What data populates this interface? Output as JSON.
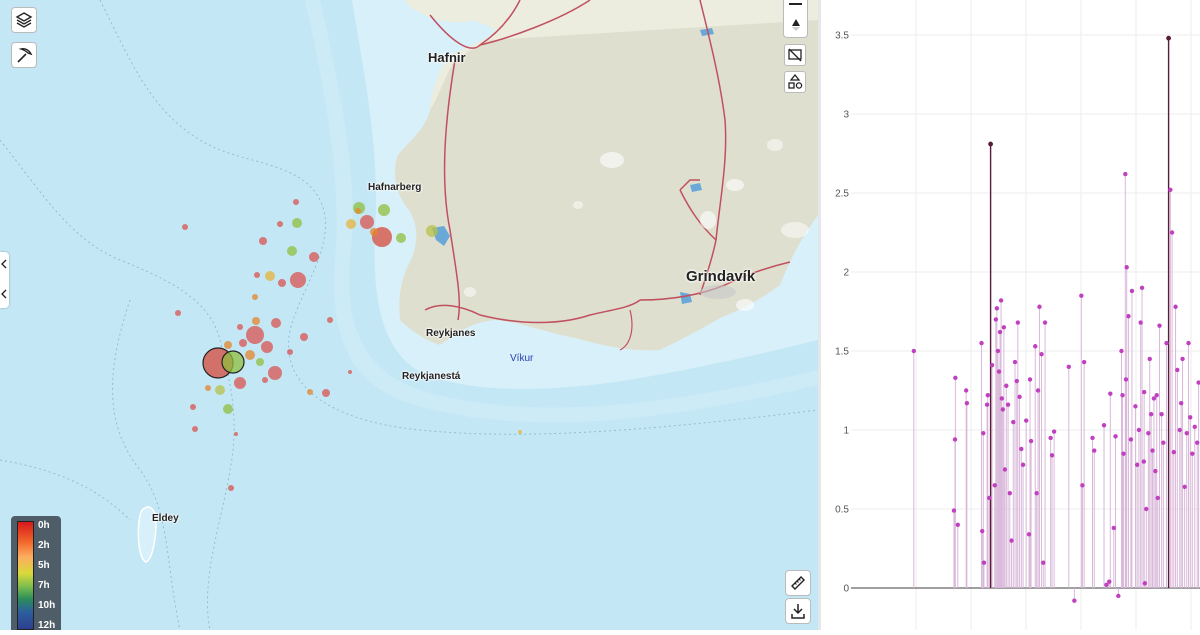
{
  "map": {
    "places": {
      "hafnir": "Hafnir",
      "hafnarberg": "Hafnarberg",
      "grindavik": "Grindavík",
      "reykjanes": "Reykjanes",
      "reykjanesta": "Reykjanestá",
      "vikur": "Víkur",
      "eldey": "Eldey"
    },
    "controls": {
      "layers_icon": "layers-icon",
      "pickaxe_icon": "pickaxe-icon",
      "zoom_out_icon": "minus-icon",
      "compass_icon": "compass-icon",
      "hide_icon": "hide-layer-icon",
      "shapes_icon": "shapes-icon",
      "ruler_icon": "ruler-icon",
      "download_icon": "download-icon"
    },
    "legend": {
      "labels": [
        "0h",
        "2h",
        "5h",
        "7h",
        "10h",
        "12h"
      ],
      "colors": [
        "#d7191c",
        "#f0652a",
        "#fdae61",
        "#d9d93a",
        "#7fbf4d",
        "#2b8c5a",
        "#2c5f9e",
        "#2c3f8f"
      ]
    }
  },
  "chart_data": {
    "type": "scatter",
    "ytick_labels": [
      "0",
      "0.5",
      "1",
      "1.5",
      "2",
      "2.5",
      "3",
      "3.5"
    ],
    "ylim": [
      -0.2,
      3.7
    ],
    "xlim": [
      0,
      100
    ],
    "grid": true,
    "stems": true,
    "colors": {
      "marker": "#c040c0",
      "highlight": "#5a1a3a",
      "stem": "#d9b8d9"
    },
    "points": [
      {
        "x": 18,
        "y": 1.5
      },
      {
        "x": 29.5,
        "y": 0.49
      },
      {
        "x": 29.8,
        "y": 0.94
      },
      {
        "x": 29.9,
        "y": 1.33
      },
      {
        "x": 30.6,
        "y": 0.4
      },
      {
        "x": 33,
        "y": 1.25
      },
      {
        "x": 33.2,
        "y": 1.17
      },
      {
        "x": 37.4,
        "y": 1.55
      },
      {
        "x": 37.6,
        "y": 0.36
      },
      {
        "x": 37.9,
        "y": 0.98
      },
      {
        "x": 38.1,
        "y": 0.16
      },
      {
        "x": 39,
        "y": 1.16
      },
      {
        "x": 39.2,
        "y": 1.22
      },
      {
        "x": 39.6,
        "y": 0.57
      },
      {
        "x": 40,
        "y": 2.81
      },
      {
        "x": 40.4,
        "y": 1.41
      },
      {
        "x": 41.2,
        "y": 0.65
      },
      {
        "x": 41.5,
        "y": 1.7
      },
      {
        "x": 41.8,
        "y": 1.77
      },
      {
        "x": 42.1,
        "y": 1.5
      },
      {
        "x": 42.4,
        "y": 1.37
      },
      {
        "x": 42.7,
        "y": 1.62
      },
      {
        "x": 43,
        "y": 1.82
      },
      {
        "x": 43.2,
        "y": 1.2
      },
      {
        "x": 43.5,
        "y": 1.13
      },
      {
        "x": 43.8,
        "y": 1.65
      },
      {
        "x": 44.1,
        "y": 0.75
      },
      {
        "x": 44.5,
        "y": 1.28
      },
      {
        "x": 45,
        "y": 1.16
      },
      {
        "x": 45.5,
        "y": 0.6
      },
      {
        "x": 46,
        "y": 0.3
      },
      {
        "x": 46.5,
        "y": 1.05
      },
      {
        "x": 47,
        "y": 1.43
      },
      {
        "x": 47.5,
        "y": 1.31
      },
      {
        "x": 47.8,
        "y": 1.68
      },
      {
        "x": 48.3,
        "y": 1.21
      },
      {
        "x": 48.8,
        "y": 0.88
      },
      {
        "x": 49.3,
        "y": 0.78
      },
      {
        "x": 50.2,
        "y": 1.06
      },
      {
        "x": 51,
        "y": 0.34
      },
      {
        "x": 51.3,
        "y": 1.32
      },
      {
        "x": 51.6,
        "y": 0.93
      },
      {
        "x": 52.8,
        "y": 1.53
      },
      {
        "x": 53.2,
        "y": 0.6
      },
      {
        "x": 53.6,
        "y": 1.25
      },
      {
        "x": 54,
        "y": 1.78
      },
      {
        "x": 54.6,
        "y": 1.48
      },
      {
        "x": 55.1,
        "y": 0.16
      },
      {
        "x": 55.6,
        "y": 1.68
      },
      {
        "x": 57.2,
        "y": 0.95
      },
      {
        "x": 57.6,
        "y": 0.84
      },
      {
        "x": 58.2,
        "y": 0.99
      },
      {
        "x": 62.4,
        "y": 1.4
      },
      {
        "x": 64,
        "y": -0.08
      },
      {
        "x": 66,
        "y": 1.85
      },
      {
        "x": 66.3,
        "y": 0.65
      },
      {
        "x": 66.8,
        "y": 1.43
      },
      {
        "x": 69.2,
        "y": 0.95
      },
      {
        "x": 69.7,
        "y": 0.87
      },
      {
        "x": 72.5,
        "y": 1.03
      },
      {
        "x": 73.2,
        "y": 0.02
      },
      {
        "x": 74,
        "y": 0.04
      },
      {
        "x": 74.3,
        "y": 1.23
      },
      {
        "x": 75.3,
        "y": 0.38
      },
      {
        "x": 75.8,
        "y": 0.96
      },
      {
        "x": 76.6,
        "y": -0.05
      },
      {
        "x": 77.5,
        "y": 1.5
      },
      {
        "x": 77.8,
        "y": 1.22
      },
      {
        "x": 78.1,
        "y": 0.85
      },
      {
        "x": 78.6,
        "y": 2.62
      },
      {
        "x": 78.8,
        "y": 1.32
      },
      {
        "x": 79,
        "y": 2.03
      },
      {
        "x": 79.5,
        "y": 1.72
      },
      {
        "x": 80.2,
        "y": 0.94
      },
      {
        "x": 80.5,
        "y": 1.88
      },
      {
        "x": 81.5,
        "y": 1.15
      },
      {
        "x": 82,
        "y": 0.78
      },
      {
        "x": 82.5,
        "y": 1.0
      },
      {
        "x": 83,
        "y": 1.68
      },
      {
        "x": 83.4,
        "y": 1.9
      },
      {
        "x": 83.9,
        "y": 0.8
      },
      {
        "x": 84,
        "y": 1.24
      },
      {
        "x": 84.2,
        "y": 0.03
      },
      {
        "x": 84.6,
        "y": 0.5
      },
      {
        "x": 85.2,
        "y": 0.98
      },
      {
        "x": 85.6,
        "y": 1.45
      },
      {
        "x": 86,
        "y": 1.1
      },
      {
        "x": 86.4,
        "y": 0.87
      },
      {
        "x": 86.8,
        "y": 1.2
      },
      {
        "x": 87.2,
        "y": 0.74
      },
      {
        "x": 87.6,
        "y": 1.22
      },
      {
        "x": 87.9,
        "y": 0.57
      },
      {
        "x": 88.4,
        "y": 1.66
      },
      {
        "x": 89,
        "y": 1.1
      },
      {
        "x": 89.5,
        "y": 0.92
      },
      {
        "x": 90.4,
        "y": 1.55
      },
      {
        "x": 91,
        "y": 3.48
      },
      {
        "x": 91.5,
        "y": 2.52
      },
      {
        "x": 92,
        "y": 2.25
      },
      {
        "x": 92.5,
        "y": 0.86
      },
      {
        "x": 93,
        "y": 1.78
      },
      {
        "x": 93.5,
        "y": 1.38
      },
      {
        "x": 94.2,
        "y": 1.0
      },
      {
        "x": 94.6,
        "y": 1.17
      },
      {
        "x": 95,
        "y": 1.45
      },
      {
        "x": 95.6,
        "y": 0.64
      },
      {
        "x": 96.2,
        "y": 0.98
      },
      {
        "x": 96.7,
        "y": 1.55
      },
      {
        "x": 97.2,
        "y": 1.08
      },
      {
        "x": 97.8,
        "y": 0.85
      },
      {
        "x": 98.5,
        "y": 1.02
      },
      {
        "x": 99.2,
        "y": 0.92
      },
      {
        "x": 99.6,
        "y": 1.3
      }
    ],
    "highlight_points": [
      2.81,
      3.48
    ]
  }
}
